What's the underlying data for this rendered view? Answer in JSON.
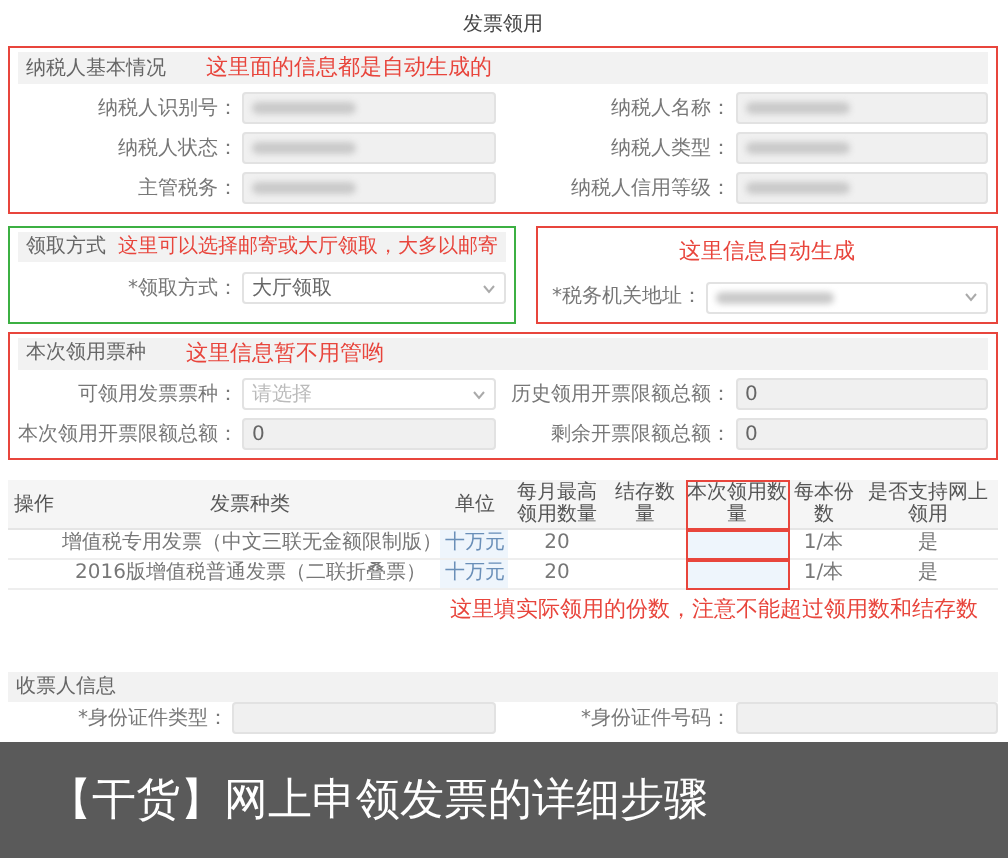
{
  "title": "发票领用",
  "taxpayer": {
    "heading": "纳税人基本情况",
    "note": "这里面的信息都是自动生成的",
    "fields": [
      {
        "label": "纳税人识别号："
      },
      {
        "label": "纳税人名称："
      },
      {
        "label": "纳税人状态："
      },
      {
        "label": "纳税人类型："
      },
      {
        "label": "主管税务："
      },
      {
        "label": "纳税人信用等级："
      }
    ]
  },
  "pickup": {
    "heading": "领取方式",
    "note": "这里可以选择邮寄或大厅领取，大多以邮寄",
    "label": "*领取方式：",
    "value": "大厅领取"
  },
  "office": {
    "note": "这里信息自动生成",
    "label": "*税务机关地址："
  },
  "usage": {
    "heading": "本次领用票种",
    "note": "这里信息暂不用管哟",
    "fields": [
      {
        "kind": "select",
        "label": "可领用发票票种：",
        "placeholder": "请选择"
      },
      {
        "kind": "input",
        "label": "历史领用开票限额总额：",
        "value": "0"
      },
      {
        "kind": "input",
        "label": "本次领用开票限额总额：",
        "value": "0"
      },
      {
        "kind": "input",
        "label": "剩余开票限额总额：",
        "value": "0"
      }
    ]
  },
  "table": {
    "columns": [
      {
        "label": "操作",
        "highlighted": false
      },
      {
        "label": "发票种类",
        "highlighted": false
      },
      {
        "label": "单位",
        "highlighted": false
      },
      {
        "label": "每月最高领用数量",
        "highlighted": false
      },
      {
        "label": "结存数量",
        "highlighted": false
      },
      {
        "label": "本次领用数量",
        "highlighted": true
      },
      {
        "label": "每本份数",
        "highlighted": false
      },
      {
        "label": "是否支持网上领用",
        "highlighted": false
      }
    ],
    "rows": [
      [
        "",
        "增值税专用发票（中文三联无金额限制版）",
        "十万元",
        "20",
        "",
        "",
        "1/本",
        "是"
      ],
      [
        "",
        "2016版增值税普通发票（二联折叠票）",
        "十万元",
        "20",
        "",
        "",
        "1/本",
        "是"
      ]
    ],
    "note": "这里填实际领用的份数，注意不能超过领用数和结存数"
  },
  "receiver": {
    "heading": "收票人信息",
    "fields": [
      {
        "label": "*身份证件类型："
      },
      {
        "label": "*身份证件号码："
      }
    ]
  },
  "caption": "【干货】网上申领发票的详细步骤"
}
